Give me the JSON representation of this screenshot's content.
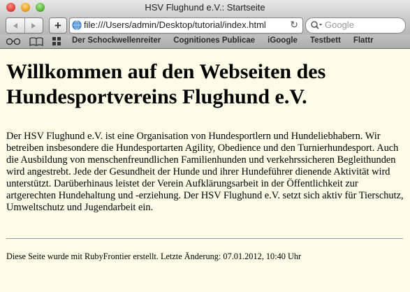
{
  "window": {
    "title": "HSV Flughund e.V.: Startseite"
  },
  "toolbar": {
    "back_icon": "back-arrow",
    "forward_icon": "forward-arrow",
    "add_label": "+",
    "url": "file:///Users/admin/Desktop/tutorial/index.html",
    "reload_icon": "reload",
    "search_placeholder": "Google"
  },
  "bookmarks": {
    "items": [
      "Der Schockwellenreiter",
      "Cognitiones Publicae",
      "iGoogle",
      "Testbett",
      "Flattr"
    ]
  },
  "page": {
    "heading": "Willkommen auf den Webseiten des Hundesportvereins Flughund e.V.",
    "paragraph": "Der HSV Flughund e.V. ist eine Organisation von Hundesportlern und Hundeliebhabern. Wir betreiben insbesondere die Hundesportarten Agility, Obedience und den Turnierhundesport. Auch die Ausbildung von menschenfreundlichen Familienhunden und verkehrssicheren Begleithunden wird angestrebt. Jede der Gesundheit der Hunde und ihrer Hundeführer dienende Aktivität wird unterstützt. Darüberhinaus leistet der Verein Aufklärungsarbeit in der Öffentlichkeit zur artgerechten Hundehaltung und -erziehung. Der HSV Flughund e.V. setzt sich aktiv für Tierschutz, Umweltschutz und Jugendarbeit ein.",
    "footer": "Diese Seite wurde mit RubyFrontier erstellt. Letzte Änderung: 07.01.2012, 10:40 Uhr"
  }
}
